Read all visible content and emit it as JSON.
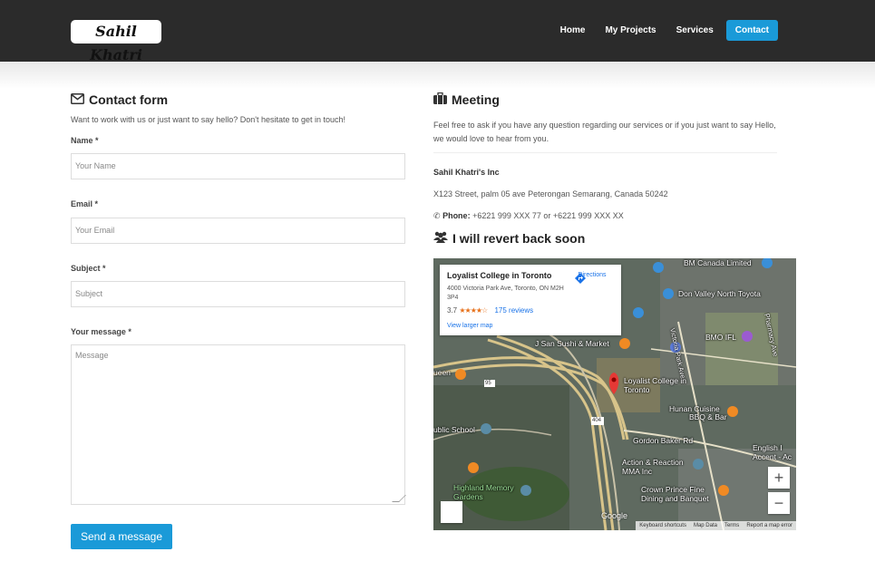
{
  "header": {
    "logo": "Sahil Khatri",
    "nav": [
      {
        "label": "Home"
      },
      {
        "label": "My Projects"
      },
      {
        "label": "Services"
      },
      {
        "label": "Contact",
        "active": true
      }
    ],
    "accent": "#1a9ad8"
  },
  "contact_form": {
    "title": "Contact form",
    "subtitle": "Want to work with us or just want to say hello? Don't hesitate to get in touch!",
    "name_label": "Name *",
    "name_placeholder": "Your Name",
    "email_label": "Email *",
    "email_placeholder": "Your Email",
    "subject_label": "Subject *",
    "subject_placeholder": "Subject",
    "message_label": "Your message *",
    "message_placeholder": "Message",
    "submit_label": "Send a message"
  },
  "meeting": {
    "title": "Meeting",
    "subtitle": "Feel free to ask if you have any question regarding our services or if you just want to say Hello, we would love to hear from you.",
    "company": "Sahil Khatri's Inc",
    "address": "X123 Street, palm 05 ave Peterongan Semarang, Canada 50242",
    "phone_label": "Phone:",
    "phone_value": "+6221 999 XXX 77 or +6221 999 XXX XX",
    "revert_title": "I will revert back soon"
  },
  "map": {
    "place_name": "Loyalist College in Toronto",
    "place_address": "4000 Victoria Park Ave, Toronto, ON M2H 3P4",
    "rating": "3.7",
    "stars": "★★★★☆",
    "reviews": "175 reviews",
    "directions": "Directions",
    "larger_map": "View larger map",
    "labels": {
      "bm_canada": "BM Canada Limited",
      "don_valley": "Don Valley North Toyota",
      "bmo": "BMO IFL",
      "j_san": "J San Sushi & Market",
      "queen": "ueen",
      "loyalist": "Loyalist College in Toronto",
      "hunan": "Hunan Cuisine",
      "bbq": "BBQ & Bar",
      "public_school": "ublic School",
      "gordon_baker": "Gordon Baker Rd",
      "action_reaction": "Action & Reaction MMA Inc",
      "crown_prince": "Crown Prince Fine Dining and Banquet",
      "highland": "Highland Memory Gardens",
      "english": "English I Accent - Ac",
      "victoria_park": "Victoria Park Ave",
      "pharmacy": "Pharmacy Ave",
      "hwy404": "404",
      "hwy95": "95"
    },
    "zoom_in": "+",
    "zoom_out": "−",
    "google": "Google",
    "footer": {
      "shortcuts": "Keyboard shortcuts",
      "map_data": "Map Data",
      "terms": "Terms",
      "report": "Report a map error"
    }
  }
}
